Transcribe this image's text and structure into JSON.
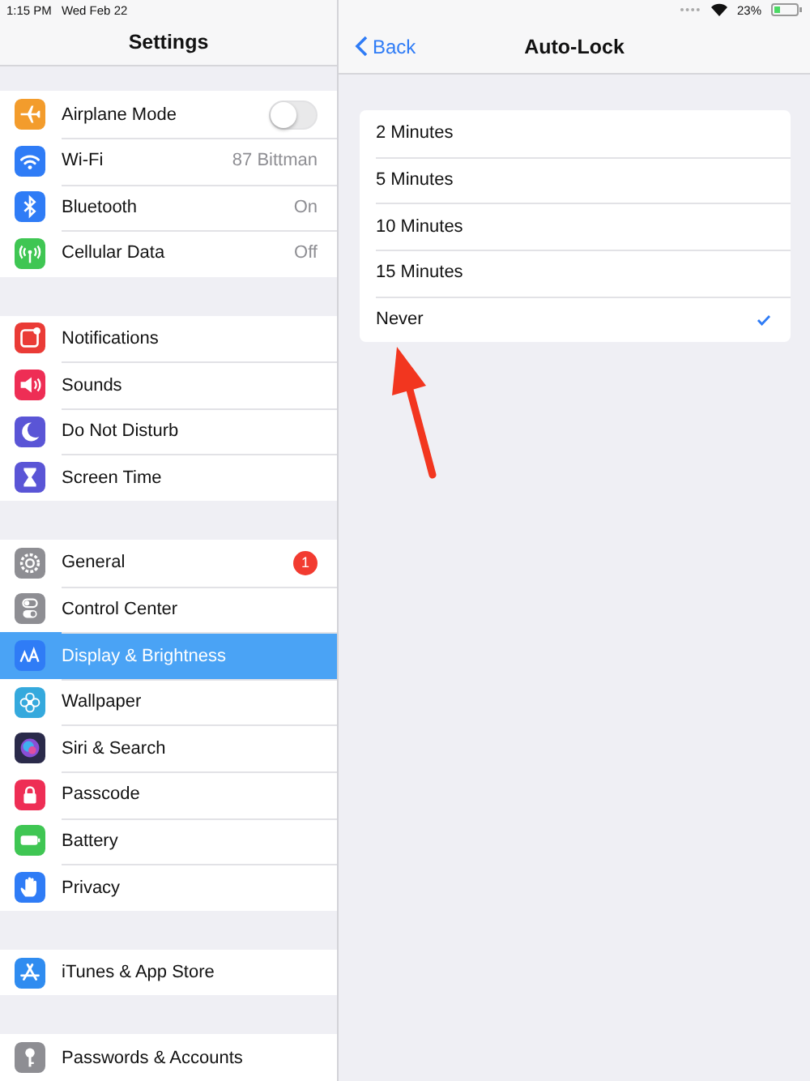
{
  "status_bar": {
    "time": "1:15 PM",
    "date": "Wed Feb 22",
    "battery": "23%"
  },
  "sidebar": {
    "title": "Settings",
    "groups": [
      [
        {
          "label": "Airplane Mode",
          "color": "#f39c2c",
          "kind": "toggle",
          "on": false,
          "selected": false
        },
        {
          "label": "Wi-Fi",
          "color": "#2f7cf6",
          "kind": "value",
          "value": "87 Bittman",
          "selected": false
        },
        {
          "label": "Bluetooth",
          "color": "#2f7cf6",
          "kind": "value",
          "value": "On",
          "selected": false
        },
        {
          "label": "Cellular Data",
          "color": "#3fc653",
          "kind": "value",
          "value": "Off",
          "selected": false
        }
      ],
      [
        {
          "label": "Notifications",
          "color": "#ea3b36",
          "kind": "plain",
          "selected": false
        },
        {
          "label": "Sounds",
          "color": "#ee2e55",
          "kind": "plain",
          "selected": false
        },
        {
          "label": "Do Not Disturb",
          "color": "#5a55d6",
          "kind": "plain",
          "selected": false
        },
        {
          "label": "Screen Time",
          "color": "#5a55d6",
          "kind": "plain",
          "selected": false
        }
      ],
      [
        {
          "label": "General",
          "color": "#8e8e93",
          "kind": "badge",
          "badge": "1",
          "selected": false
        },
        {
          "label": "Control Center",
          "color": "#8e8e93",
          "kind": "plain",
          "selected": false
        },
        {
          "label": "Display & Brightness",
          "color": "#2f7cf6",
          "kind": "plain",
          "selected": true
        },
        {
          "label": "Wallpaper",
          "color": "#35a9dd",
          "kind": "plain",
          "selected": false
        },
        {
          "label": "Siri & Search",
          "color": "#2a2a4a",
          "kind": "plain",
          "selected": false
        },
        {
          "label": "Passcode",
          "color": "#ee2e55",
          "kind": "plain",
          "selected": false
        },
        {
          "label": "Battery",
          "color": "#3fc653",
          "kind": "plain",
          "selected": false
        },
        {
          "label": "Privacy",
          "color": "#2f7cf6",
          "kind": "plain",
          "selected": false
        }
      ],
      [
        {
          "label": "iTunes & App Store",
          "color": "#2f8cf0",
          "kind": "plain",
          "selected": false
        }
      ],
      [
        {
          "label": "Passwords & Accounts",
          "color": "#8e8e93",
          "kind": "plain",
          "selected": false
        }
      ]
    ]
  },
  "detail": {
    "back": "Back",
    "title": "Auto-Lock",
    "options": [
      {
        "label": "2 Minutes",
        "selected": false
      },
      {
        "label": "5 Minutes",
        "selected": false
      },
      {
        "label": "10 Minutes",
        "selected": false
      },
      {
        "label": "15 Minutes",
        "selected": false
      },
      {
        "label": "Never",
        "selected": true
      }
    ]
  }
}
